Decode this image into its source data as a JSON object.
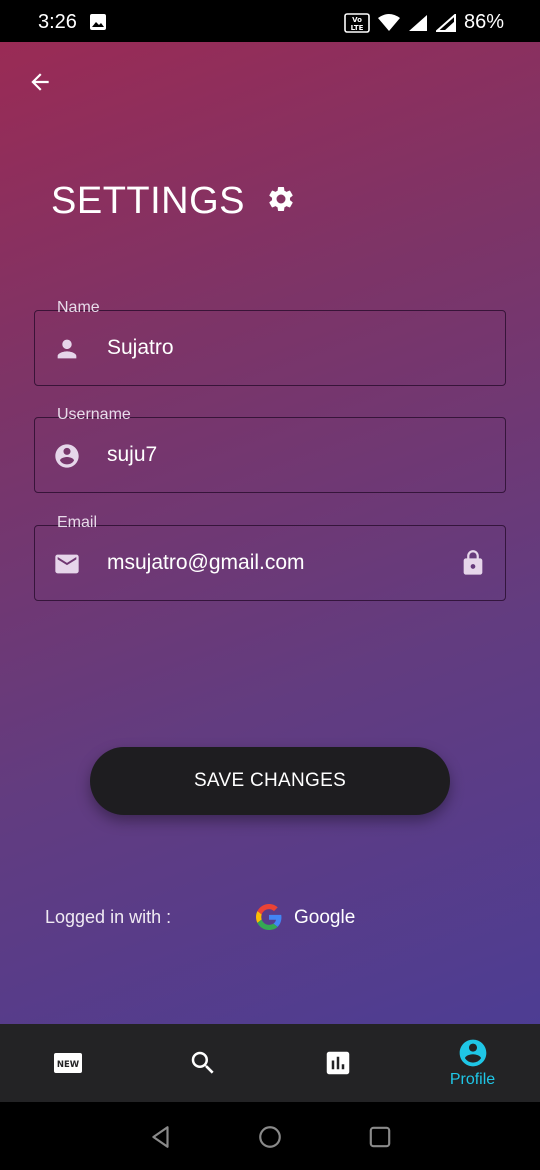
{
  "status_bar": {
    "time": "3:26",
    "battery": "86%",
    "volte": "Vo LTE"
  },
  "header": {
    "title": "SETTINGS"
  },
  "form": {
    "name": {
      "label": "Name",
      "value": "Sujatro"
    },
    "username": {
      "label": "Username",
      "value": "suju7"
    },
    "email": {
      "label": "Email",
      "value": "msujatro@gmail.com"
    }
  },
  "actions": {
    "save_label": "SAVE CHANGES"
  },
  "login": {
    "label": "Logged in with :",
    "provider": "Google"
  },
  "bottom_nav": {
    "items": [
      {
        "icon": "new-icon"
      },
      {
        "icon": "search-icon"
      },
      {
        "icon": "chart-icon"
      },
      {
        "icon": "profile-icon",
        "label": "Profile",
        "active": true
      }
    ],
    "active_color": "#1fc6e6"
  },
  "colors": {
    "gradient_top": "#9a2b55",
    "gradient_bottom": "#4d3d93",
    "button_bg": "#1e1d20"
  }
}
